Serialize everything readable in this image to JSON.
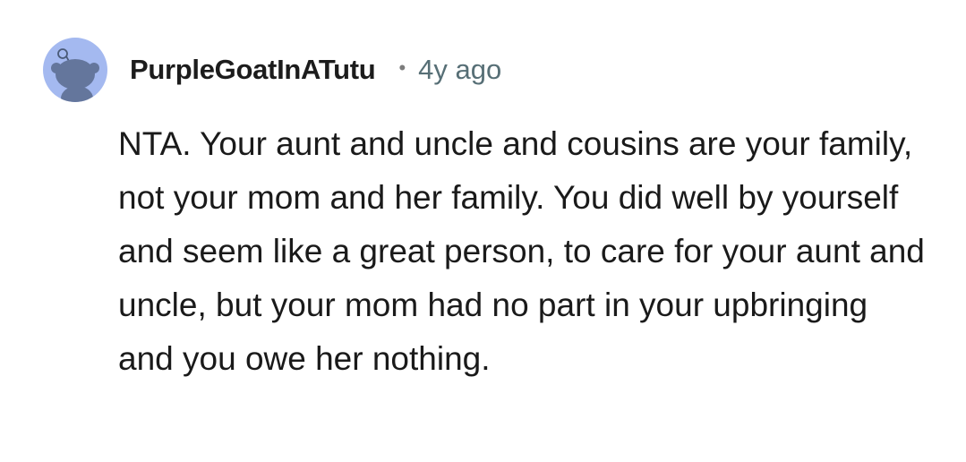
{
  "comment": {
    "username": "PurpleGoatInATutu",
    "separator": "•",
    "timestamp": "4y ago",
    "body": "NTA. Your aunt and uncle and cousins are your family, not your mom and her family. You did well by yourself and seem like a great person, to care for your aunt and uncle, but your mom had no part in your upbringing and you owe her nothing.",
    "avatar_icon": "snoo-avatar-icon",
    "avatar_color": "#a4b9f0"
  }
}
